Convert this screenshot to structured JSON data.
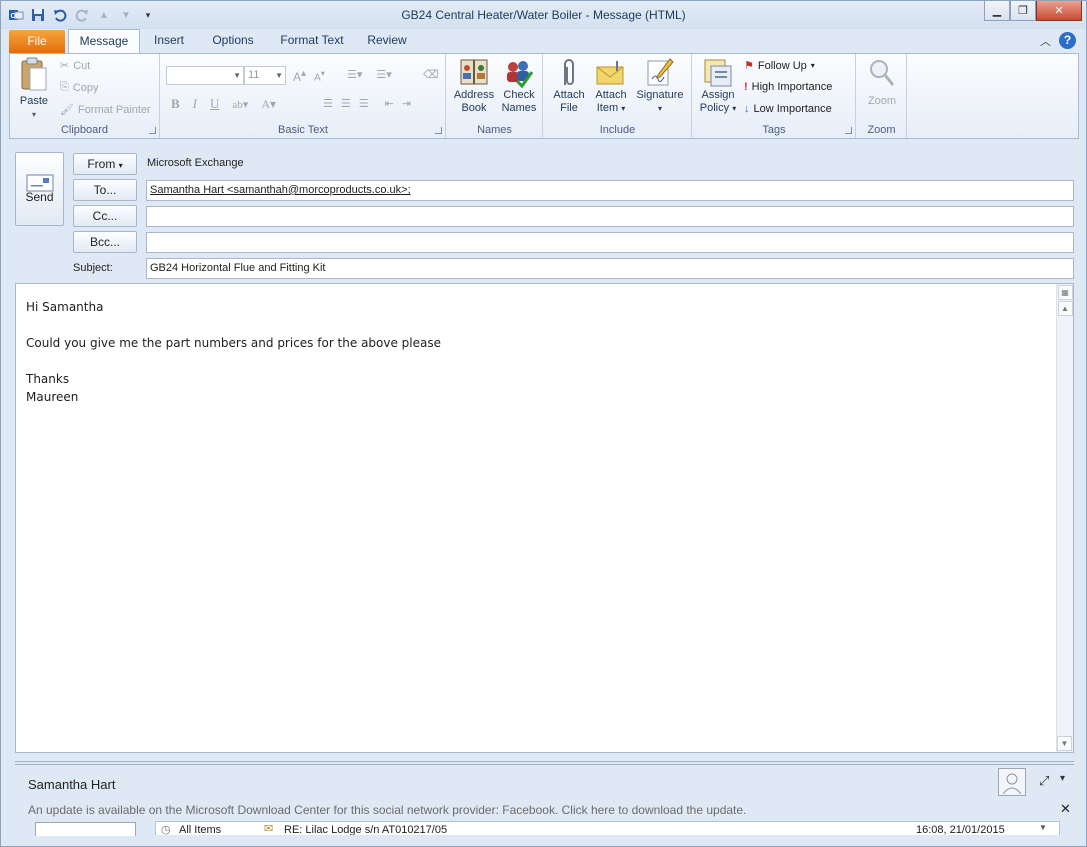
{
  "window": {
    "title": "GB24 Central Heater/Water Boiler  -  Message (HTML)",
    "controls": {
      "minimize": "▁",
      "maximize": "❐",
      "close": "✕"
    }
  },
  "ribbon": {
    "tabs": [
      "File",
      "Message",
      "Insert",
      "Options",
      "Format Text",
      "Review"
    ],
    "active_tab": "Message",
    "clipboard": {
      "paste": "Paste",
      "cut": "Cut",
      "copy": "Copy",
      "format_painter": "Format Painter",
      "label": "Clipboard"
    },
    "basic_text": {
      "font_size": "11",
      "label": "Basic Text"
    },
    "names": {
      "address_book_1": "Address",
      "address_book_2": "Book",
      "check_names_1": "Check",
      "check_names_2": "Names",
      "label": "Names"
    },
    "include": {
      "attach_file_1": "Attach",
      "attach_file_2": "File",
      "attach_item_1": "Attach",
      "attach_item_2": "Item",
      "signature": "Signature",
      "label": "Include"
    },
    "tags": {
      "assign_policy_1": "Assign",
      "assign_policy_2": "Policy",
      "follow_up": "Follow Up",
      "high_importance": "High Importance",
      "low_importance": "Low Importance",
      "label": "Tags"
    },
    "zoom": {
      "zoom": "Zoom",
      "label": "Zoom"
    }
  },
  "compose": {
    "send": "Send",
    "from_button": "From",
    "from_value": "Microsoft Exchange",
    "to_button": "To...",
    "to_value": "Samantha Hart <samanthah@morcoproducts.co.uk>;",
    "cc_button": "Cc...",
    "cc_value": "",
    "bcc_button": "Bcc...",
    "bcc_value": "",
    "subject_label": "Subject:",
    "subject_value": "GB24 Horizontal Flue and Fitting Kit",
    "body_lines": [
      "Hi Samantha",
      "",
      "Could you give me the part numbers and prices for the above please",
      "",
      "Thanks",
      "Maureen"
    ]
  },
  "people_pane": {
    "name": "Samantha Hart",
    "notice": "An update is available on the Microsoft Download Center for this social network provider: Facebook. Click here to download the update.",
    "feed_folder": "All Items",
    "feed_subject": "RE: Lilac Lodge s/n AT010217/05",
    "feed_time": "16:08, 21/01/2015"
  }
}
